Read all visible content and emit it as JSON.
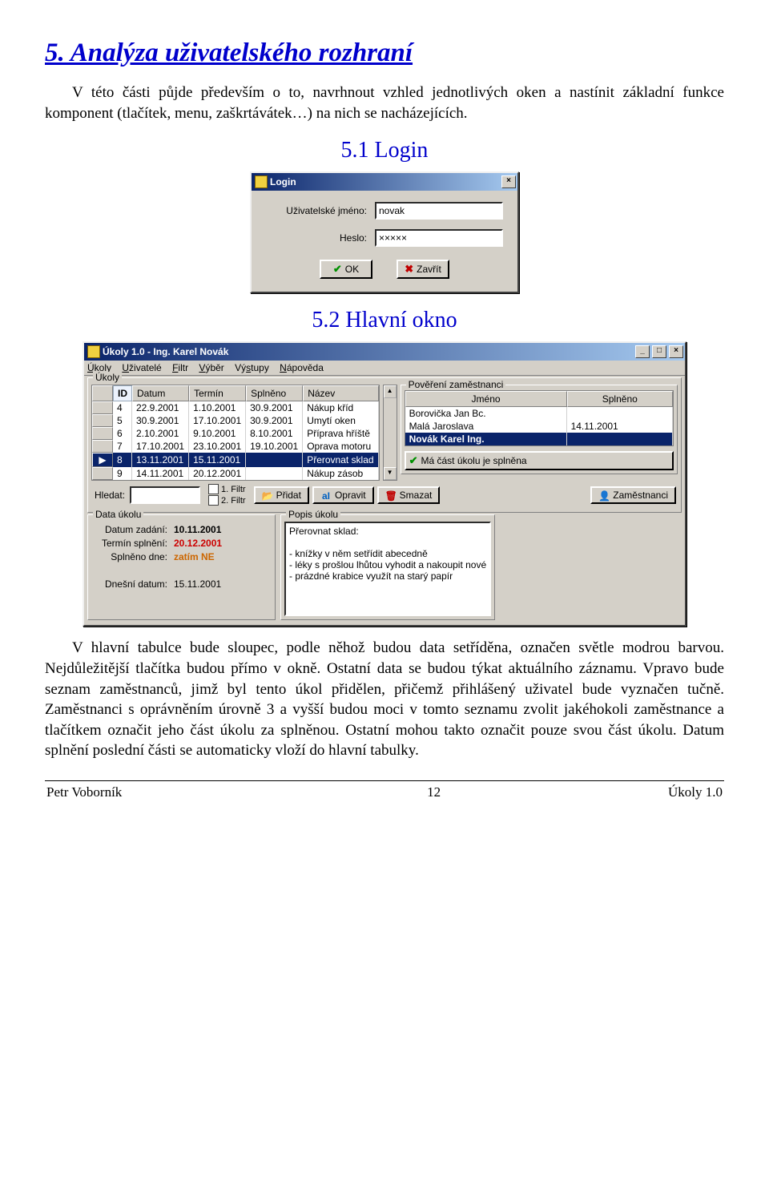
{
  "heading1": "5. Analýza uživatelského rozhraní",
  "para1": "V této části půjde především o to, navrhnout vzhled jednotlivých oken a nastínit základní funkce komponent (tlačítek, menu, zaškrtávátek…) na nich se nacházejících.",
  "heading2a": "5.1  Login",
  "heading2b": "5.2  Hlavní okno",
  "para2": "V hlavní tabulce bude sloupec, podle něhož budou data setříděna, označen světle modrou barvou. Nejdůležitější tlačítka budou přímo v okně. Ostatní data se budou týkat aktuálního záznamu. Vpravo bude seznam zaměstnanců, jimž byl tento úkol přidělen, přičemž přihlášený uživatel bude vyznačen tučně. Zaměstnanci s oprávněním úrovně 3 a vyšší budou moci v tomto seznamu zvolit jakéhokoli zaměstnance a tlačítkem označit jeho část úkolu za splněnou. Ostatní mohou takto označit pouze svou část úkolu. Datum splnění poslední části se automaticky vloží do hlavní tabulky.",
  "login": {
    "title": "Login",
    "user_label": "Uživatelské jméno:",
    "user_value": "novak",
    "pass_label": "Heslo:",
    "pass_value": "×××××",
    "ok": "OK",
    "close": "Zavřít"
  },
  "main": {
    "title": "Úkoly 1.0 - Ing. Karel Novák",
    "menu": [
      "Úkoly",
      "Uživatelé",
      "Filtr",
      "Výběr",
      "Výstupy",
      "Nápověda"
    ],
    "group_tasks": "Úkoly",
    "group_emp": "Pověření zaměstnanci",
    "cols": [
      "ID",
      "Datum",
      "Termín",
      "Splněno",
      "Název"
    ],
    "rows": [
      {
        "id": "4",
        "d": "22.9.2001",
        "t": "1.10.2001",
        "s": "30.9.2001",
        "n": "Nákup kříd"
      },
      {
        "id": "5",
        "d": "30.9.2001",
        "t": "17.10.2001",
        "s": "30.9.2001",
        "n": "Umytí oken"
      },
      {
        "id": "6",
        "d": "2.10.2001",
        "t": "9.10.2001",
        "s": "8.10.2001",
        "n": "Příprava hříště"
      },
      {
        "id": "7",
        "d": "17.10.2001",
        "t": "23.10.2001",
        "s": "19.10.2001",
        "n": "Oprava motoru"
      },
      {
        "id": "8",
        "d": "13.11.2001",
        "t": "15.11.2001",
        "s": "",
        "n": "Přerovnat sklad"
      },
      {
        "id": "9",
        "d": "14.11.2001",
        "t": "20.12.2001",
        "s": "",
        "n": "Nákup zásob"
      }
    ],
    "emp_cols": [
      "Jméno",
      "Splněno"
    ],
    "emp_rows": [
      {
        "name": "Borovička Jan Bc.",
        "s": ""
      },
      {
        "name": "Malá Jaroslava",
        "s": "14.11.2001"
      },
      {
        "name": "Novák Karel Ing.",
        "s": ""
      }
    ],
    "emp_status": "Má část úkolu je splněna",
    "search_label": "Hledat:",
    "filter1": "1. Filtr",
    "filter2": "2. Filtr",
    "btn_add": "Přidat",
    "btn_edit": "Opravit",
    "btn_del": "Smazat",
    "btn_emp": "Zaměstnanci",
    "group_data": "Data úkolu",
    "group_desc": "Popis úkolu",
    "d_zadani_l": "Datum zadání:",
    "d_zadani_v": "10.11.2001",
    "d_termin_l": "Termín splnění:",
    "d_termin_v": "20.12.2001",
    "d_splneno_l": "Splněno dne:",
    "d_splneno_v": "zatím NE",
    "d_dnes_l": "Dnešní datum:",
    "d_dnes_v": "15.11.2001",
    "desc_title": "Přerovnat sklad:",
    "desc_lines": [
      "- knížky v něm setřídit abecedně",
      "- léky s prošlou lhůtou vyhodit a nakoupit nové",
      "- prázdné krabice využít na starý papír"
    ]
  },
  "footer": {
    "left": "Petr Voborník",
    "center": "12",
    "right": "Úkoly 1.0"
  }
}
